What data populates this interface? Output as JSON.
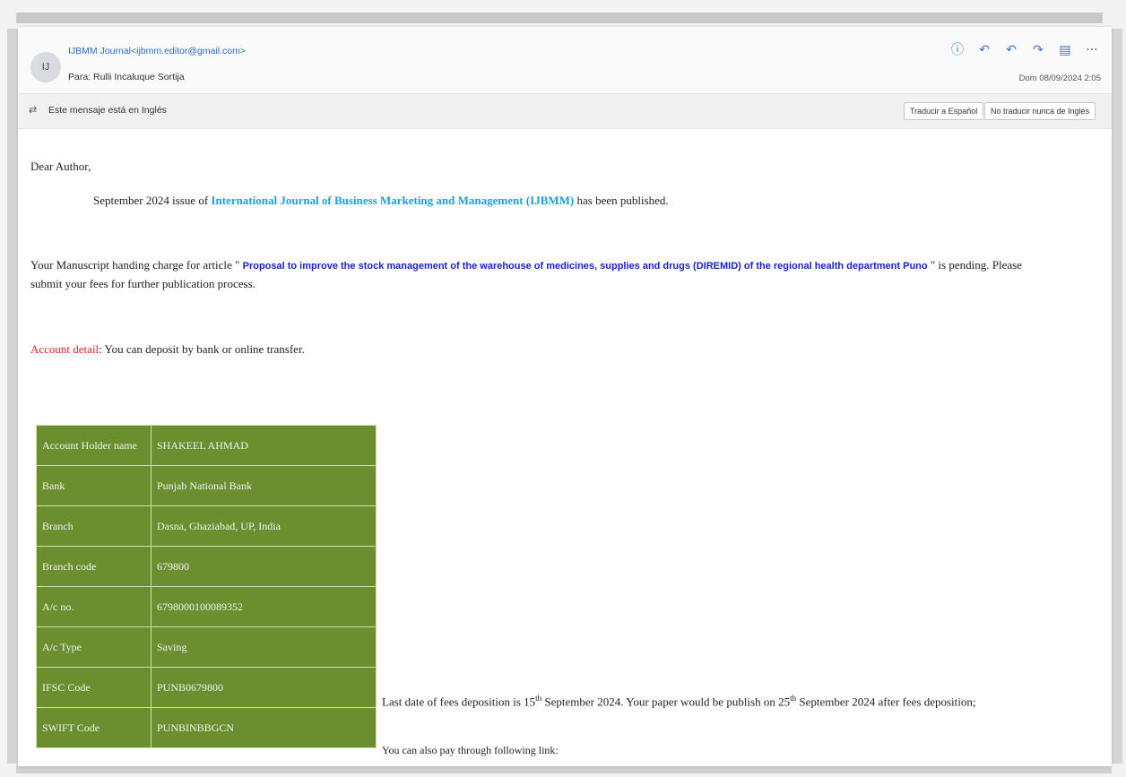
{
  "email": {
    "avatar_initials": "IJ",
    "from": "IJBMM Journal<ijbmm.editor@gmail.com>",
    "to": "Para: Rulli Incaluque Sortija",
    "date": "Dom 08/09/2024 2:05",
    "actions": [
      {
        "icon": "sensitivity-icon",
        "glyph": "ⓘ"
      },
      {
        "icon": "reply-icon",
        "glyph": "↶"
      },
      {
        "icon": "reply-all-icon",
        "glyph": "↶"
      },
      {
        "icon": "forward-icon",
        "glyph": "↷"
      },
      {
        "icon": "notes-icon",
        "glyph": "▤"
      },
      {
        "icon": "more-icon",
        "glyph": "···"
      }
    ]
  },
  "translation_bar": {
    "message": "Este mensaje está en Inglés",
    "translate_button": "Traducir a Español",
    "never_translate_button": "No traducir nunca de Inglés"
  },
  "body": {
    "greeting": "Dear Author,",
    "issue_prefix": "September 2024 issue of ",
    "journal_name": "International Journal of Business Marketing and Management (IJBMM)",
    "issue_suffix": " has been published.",
    "manuscript_prefix": "Your Manuscript handing charge for article \" ",
    "article_title": "Proposal to improve the stock management of the warehouse of medicines, supplies and drugs (DIREMID) of the regional health department Puno",
    "manuscript_suffix": " \" is pending. Please",
    "manuscript_line2": "submit your fees for further publication process.",
    "account_label": "Account detail",
    "account_text": ": You can deposit by bank or online transfer.",
    "account_table": [
      {
        "key": "Account Holder name",
        "value": "SHAKEEL AHMAD"
      },
      {
        "key": "Bank",
        "value": "Punjab National Bank"
      },
      {
        "key": "Branch",
        "value": "Dasna, Ghaziabad, UP, India"
      },
      {
        "key": "Branch code",
        "value": "679800"
      },
      {
        "key": "A/c no.",
        "value": "6798000100089352"
      },
      {
        "key": "A/c Type",
        "value": "Saving"
      },
      {
        "key": "IFSC Code",
        "value": "PUNB0679800"
      },
      {
        "key": "SWIFT Code",
        "value": "PUNBINBBGCN"
      }
    ],
    "deadline_prefix": "Last date of fees deposition is 15",
    "deadline_sup": "th",
    "deadline_mid": " September 2024. Your paper would be publish on 25",
    "deadline_sup2": "th",
    "deadline_suffix": " September 2024 after fees deposition;",
    "pay_link_text": "You can also pay through following link:"
  },
  "colors": {
    "table_bg": "#6b8e2f",
    "journal_link": "#1aa0d8",
    "article_title": "#1d21c9",
    "account_label": "#e02020"
  }
}
